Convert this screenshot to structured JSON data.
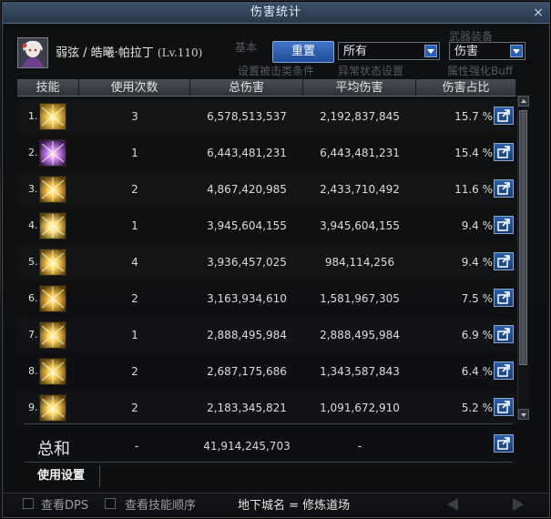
{
  "window": {
    "title": "伤害统计",
    "close": "×"
  },
  "player": {
    "name": "弱弦 / 皓曦·帕拉丁",
    "level": "(Lv.110)"
  },
  "ghost_labels": {
    "a": "基本",
    "b": "设置被击类条件",
    "c": "异常状态设置",
    "d": "属性强化Buff",
    "e": "武器装备"
  },
  "controls": {
    "reset_label": "重置",
    "filter_select": "所有",
    "type_select": "伤害"
  },
  "table": {
    "headers": [
      "技能",
      "使用次数",
      "总伤害",
      "平均伤害",
      "伤害占比"
    ],
    "rows": [
      {
        "rank": "1.",
        "icon": "skill-rays-icon",
        "uses": "3",
        "total": "6,578,513,537",
        "avg": "2,192,837,845",
        "pct": "15.7 %"
      },
      {
        "rank": "2.",
        "icon": "skill-purple-burst-icon",
        "uses": "1",
        "total": "6,443,481,231",
        "avg": "6,443,481,231",
        "pct": "15.4 %"
      },
      {
        "rank": "3.",
        "icon": "skill-spiral-icon",
        "uses": "2",
        "total": "4,867,420,985",
        "avg": "2,433,710,492",
        "pct": "11.6 %"
      },
      {
        "rank": "4.",
        "icon": "skill-starburst-icon",
        "uses": "1",
        "total": "3,945,604,155",
        "avg": "3,945,604,155",
        "pct": "9.4 %"
      },
      {
        "rank": "5.",
        "icon": "skill-radiant-icon",
        "uses": "4",
        "total": "3,936,457,025",
        "avg": "984,114,256",
        "pct": "9.4 %"
      },
      {
        "rank": "6.",
        "icon": "skill-flame-icon",
        "uses": "2",
        "total": "3,163,934,610",
        "avg": "1,581,967,305",
        "pct": "7.5 %"
      },
      {
        "rank": "7.",
        "icon": "skill-pillars-icon",
        "uses": "1",
        "total": "2,888,495,984",
        "avg": "2,888,495,984",
        "pct": "6.9 %"
      },
      {
        "rank": "8.",
        "icon": "skill-columns-icon",
        "uses": "2",
        "total": "2,687,175,686",
        "avg": "1,343,587,843",
        "pct": "6.4 %"
      },
      {
        "rank": "9.",
        "icon": "skill-fountain-icon",
        "uses": "2",
        "total": "2,183,345,821",
        "avg": "1,091,672,910",
        "pct": "5.2 %"
      }
    ]
  },
  "summary": {
    "label": "总和",
    "uses": "-",
    "total": "41,914,245,703",
    "avg": "-"
  },
  "footer": {
    "settings_tab": "使用设置",
    "show_dps": "查看DPS",
    "show_order": "查看技能顺序",
    "dungeon": "地下城名 = 修炼道场"
  },
  "colors": {
    "accent": "#2c5fb0",
    "title_bar": "#34475f",
    "gold": "#e8b040"
  }
}
